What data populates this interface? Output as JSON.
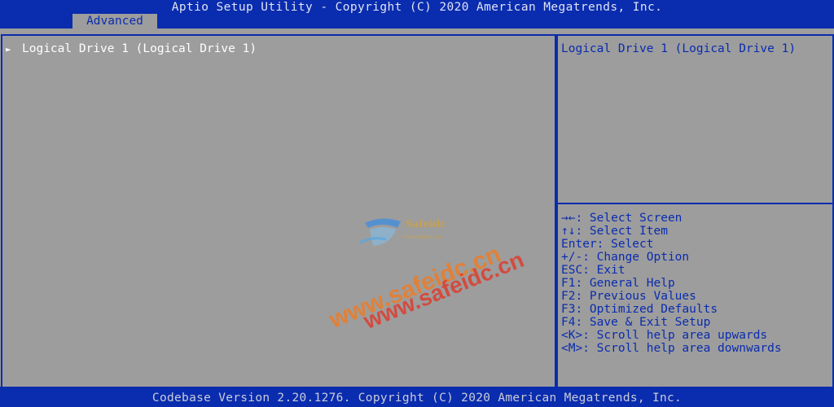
{
  "title": "Aptio Setup Utility - Copyright (C) 2020 American Megatrends, Inc.",
  "tabs": [
    {
      "label": "Advanced"
    }
  ],
  "menu": {
    "items": [
      {
        "arrow": "►",
        "label": "Logical Drive 1 (Logical Drive 1)"
      }
    ]
  },
  "help": {
    "text": "Logical Drive 1 (Logical Drive 1)"
  },
  "keys": [
    "→←: Select Screen",
    "↑↓: Select Item",
    "Enter: Select",
    "+/-: Change Option",
    "ESC: Exit",
    "F1: General Help",
    "F2: Previous Values",
    "F3: Optimized Defaults",
    "F4: Save & Exit Setup",
    "<K>: Scroll help area upwards",
    "<M>: Scroll help area downwards"
  ],
  "footer": "Codebase Version 2.20.1276. Copyright (C) 2020 American Megatrends, Inc.",
  "watermark": {
    "logo_text": "Safeidc",
    "logo_sub": "www.safeidc.cn",
    "url_1": "www.safeidc.cn",
    "url_2": "www.safeidc.cn"
  },
  "colors": {
    "bios_blue": "#0a2cae",
    "panel_gray": "#9d9d9d",
    "menu_text": "#ffffff"
  }
}
